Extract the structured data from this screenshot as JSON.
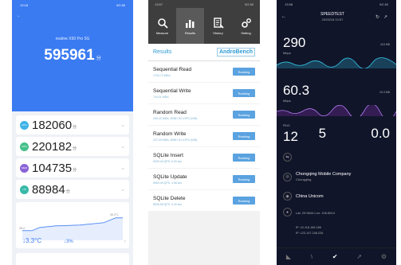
{
  "antutu": {
    "status_time": "13:18",
    "status_right": "5G 80",
    "title": "",
    "device": "realme X50 Pro 5G",
    "total_score": "595961",
    "score_unit": "分",
    "verify_text": "",
    "rows": [
      {
        "badge": "CPU",
        "score": "182060",
        "unit": "分",
        "color": "#3fb3e8"
      },
      {
        "badge": "GPU",
        "score": "220182",
        "unit": "分",
        "color": "#46c08a"
      },
      {
        "badge": "MEM",
        "score": "104735",
        "unit": "分",
        "color": "#8b63d8"
      },
      {
        "badge": "UX",
        "score": "88984",
        "unit": "分",
        "color": "#39b9a8"
      }
    ],
    "row_hint": "",
    "chart_label": "",
    "chart_high": "35.2°C",
    "chart_low": "28.4",
    "delta_temp": "↓3.3°C",
    "delta_bat": "↓3%",
    "footer_left": "",
    "footer_right": ""
  },
  "androbench": {
    "status_time": "13:57",
    "status_right": "5G 80",
    "tabs": [
      "Measure",
      "Results",
      "History",
      "Setting"
    ],
    "results_label": "Results",
    "logo": "AndroBench",
    "items": [
      {
        "title": "Sequential Read",
        "sub": "1763.72 MB/s"
      },
      {
        "title": "Sequential Write",
        "sub": "744.01 MB/s"
      },
      {
        "title": "Random Read",
        "sub": "205.42 MB/s, 52587.52 IOPS (4KB)"
      },
      {
        "title": "Random Write",
        "sub": "237.09 MB/s, 60697.51 IOPS (4KB)"
      },
      {
        "title": "SQLite Insert",
        "sub": "5003.49 QPS, 6.00 sec"
      },
      {
        "title": "SQLite Update",
        "sub": "6554.49 QPS, 4.58 sec"
      },
      {
        "title": "SQLite Delete",
        "sub": "8836.98 QPS, 3.40 sec"
      }
    ],
    "ranking_label": "Ranking"
  },
  "speedtest": {
    "status_time": "13:58",
    "status_right": "5G 80",
    "title": "SPEEDTEST",
    "datetime": "20/03/18 13:57",
    "download_label": "",
    "download_value": "290",
    "upload_label": "",
    "upload_value": "60.3",
    "unit": "Mbps",
    "download_right": [
      "",
      "415 MB"
    ],
    "upload_right": [
      "",
      "15.3 MB"
    ],
    "ping_label": "PING",
    "ping_value": "12",
    "jitter_label": "",
    "jitter_value": "5",
    "loss_label": "",
    "loss_value": "0.0",
    "ms": "",
    "connection_label": "",
    "connection_value": "",
    "server_name": "Chongqing Mobile Company",
    "server_city": "Chongqing",
    "isp": "China Unicom",
    "user_label": "",
    "latlon": "Lat: 29.5644 Lon: 106.5614",
    "internal_ip": "IP: 10.118.169.186",
    "external_ip": "IP: 123.147.248.226"
  }
}
